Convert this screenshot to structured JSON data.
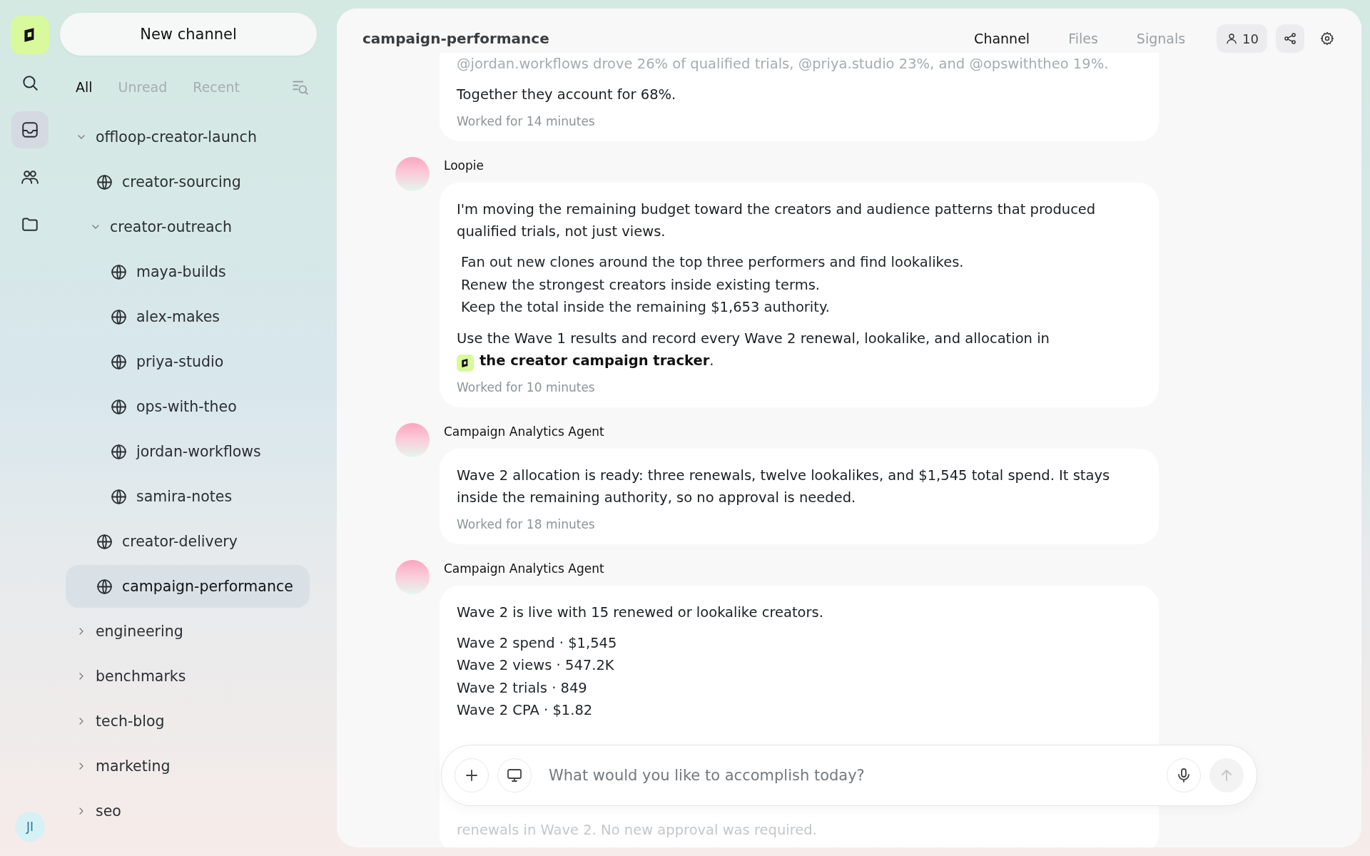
{
  "sidebar": {
    "new_button": "New channel",
    "rail": [
      {
        "kind": "search",
        "selected": false
      },
      {
        "kind": "inbox",
        "selected": true
      },
      {
        "kind": "people",
        "selected": false
      },
      {
        "kind": "folder",
        "selected": false
      }
    ],
    "filters": [
      {
        "label": "All",
        "selected": true
      },
      {
        "label": "Unread",
        "selected": false
      },
      {
        "label": "Recent",
        "selected": false
      }
    ],
    "tree": [
      {
        "kind": "group",
        "label": "offloop-creator-launch",
        "expanded": true,
        "selected": false,
        "children": [
          {
            "kind": "channel",
            "label": "creator-sourcing",
            "selected": false
          },
          {
            "kind": "group",
            "label": "creator-outreach",
            "expanded": true,
            "selected": false,
            "children": [
              {
                "kind": "channel",
                "label": "maya-builds",
                "selected": false
              },
              {
                "kind": "channel",
                "label": "alex-makes",
                "selected": false
              },
              {
                "kind": "channel",
                "label": "priya-studio",
                "selected": false
              },
              {
                "kind": "channel",
                "label": "ops-with-theo",
                "selected": false
              },
              {
                "kind": "channel",
                "label": "jordan-workflows",
                "selected": false
              },
              {
                "kind": "channel",
                "label": "samira-notes",
                "selected": false
              }
            ]
          },
          {
            "kind": "channel",
            "label": "creator-delivery",
            "selected": false
          },
          {
            "kind": "channel",
            "label": "campaign-performance",
            "selected": true
          }
        ]
      },
      {
        "kind": "group",
        "label": "engineering",
        "expanded": false,
        "selected": false
      },
      {
        "kind": "group",
        "label": "benchmarks",
        "expanded": false,
        "selected": false
      },
      {
        "kind": "group",
        "label": "tech-blog",
        "expanded": false,
        "selected": false
      },
      {
        "kind": "group",
        "label": "marketing",
        "expanded": false,
        "selected": false
      },
      {
        "kind": "group",
        "label": "seo",
        "expanded": false,
        "selected": false
      }
    ],
    "user_initials": "JI"
  },
  "header": {
    "title": "campaign-performance",
    "tabs": [
      {
        "label": "Channel",
        "selected": true
      },
      {
        "label": "Files",
        "selected": false
      },
      {
        "label": "Signals",
        "selected": false
      }
    ],
    "members": "10"
  },
  "messages": [
    {
      "faded_lead": "@jordan.workflows drove 26% of qualified trials, @priya.studio 23%, and @opswiththeo 19%.",
      "blocks": [
        {
          "kind": "para",
          "text": "Together they account for 68%."
        }
      ],
      "footer": "Worked for 14 minutes"
    },
    {
      "author": "Loopie",
      "blocks": [
        {
          "kind": "para",
          "text": "I'm moving the remaining budget toward the creators and audience patterns that produced qualified trials, not just views."
        },
        {
          "kind": "list",
          "items": [
            "Fan out new clones around the top three performers and find lookalikes.",
            "Renew the strongest creators inside existing terms.",
            "Keep the total inside the remaining $1,653 authority."
          ]
        },
        {
          "kind": "para_link",
          "before": "Use the Wave 1 results and record every Wave 2 renewal, lookalike, and allocation in ",
          "link": "the creator campaign tracker",
          "after": "."
        }
      ],
      "footer": "Worked for 10 minutes"
    },
    {
      "author": "Campaign Analytics Agent",
      "blocks": [
        {
          "kind": "para",
          "text": "Wave 2 allocation is ready: three renewals, twelve lookalikes, and $1,545 total spend. It stays inside the remaining authority, so no approval is needed."
        }
      ],
      "footer": "Worked for 18 minutes"
    },
    {
      "author": "Campaign Analytics Agent",
      "blocks": [
        {
          "kind": "para",
          "text": "Wave 2 is live with 15 renewed or lookalike creators."
        },
        {
          "kind": "lines",
          "items": [
            "Wave 2 spend · $1,545",
            "Wave 2 views · 547.2K",
            "Wave 2 trials · 849",
            "Wave 2 CPA · $1.82"
          ]
        },
        {
          "kind": "hidden_tail",
          "text": "renewals in Wave 2. No new approval was required."
        }
      ]
    }
  ],
  "composer": {
    "placeholder": "What would you like to accomplish today?"
  }
}
